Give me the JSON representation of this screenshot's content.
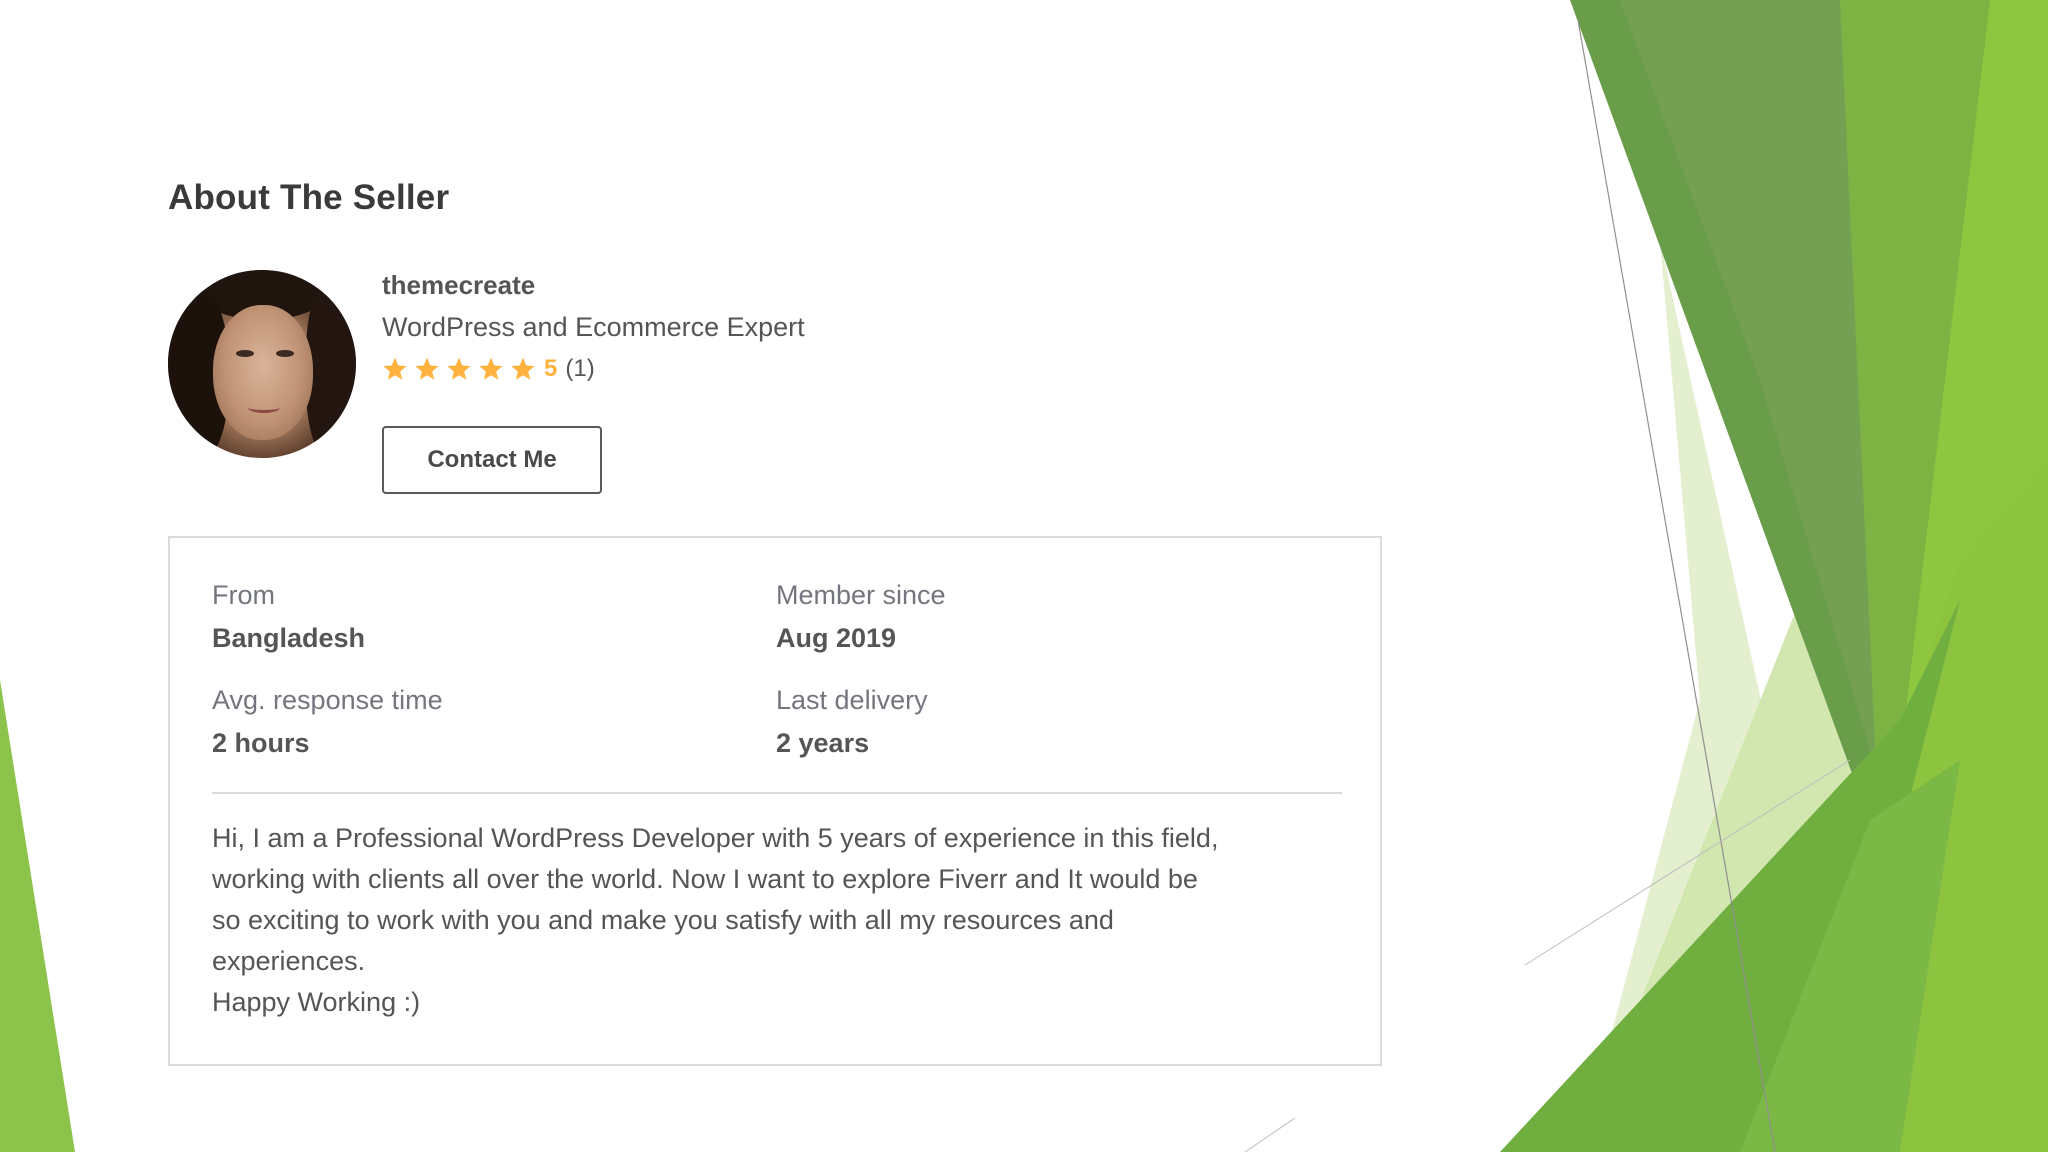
{
  "section_title": "About The Seller",
  "seller": {
    "name": "themecreate",
    "headline": "WordPress and Ecommerce Expert",
    "rating": {
      "stars": 5,
      "score": "5",
      "count": "(1)"
    },
    "contact_label": "Contact Me"
  },
  "stats": {
    "from": {
      "label": "From",
      "value": "Bangladesh"
    },
    "member_since": {
      "label": "Member since",
      "value": "Aug 2019"
    },
    "avg_response": {
      "label": "Avg. response time",
      "value": "2 hours"
    },
    "last_delivery": {
      "label": "Last delivery",
      "value": "2 years"
    }
  },
  "description": {
    "line1": "Hi, I am a Professional WordPress Developer with 5 years of experience in this field,",
    "line2": "working with clients all over the world. Now I want to explore Fiverr and It would be",
    "line3": "so exciting to work with you and make you satisfy with all my resources and",
    "line4": "experiences.",
    "line5": "Happy Working :)"
  },
  "colors": {
    "star": "#ffb33e",
    "green_dark": "#5b8f3a",
    "green_mid": "#7ab648",
    "green_light": "#9cc84f",
    "green_pale": "#d6e8b8"
  }
}
